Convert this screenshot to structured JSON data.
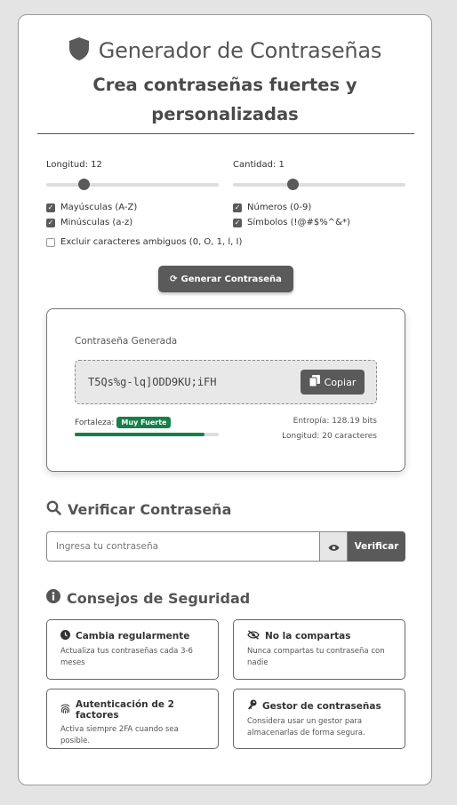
{
  "header": {
    "title": "Generador de Contraseñas",
    "subtitle_line1": "Crea contraseñas fuertes y",
    "subtitle_line2": "personalizadas"
  },
  "options": {
    "length_label": "Longitud: 12",
    "length_value": 12,
    "quantity_label": "Cantidad: 1",
    "quantity_value": 1,
    "uppercase": {
      "label": "Mayúsculas (A-Z)",
      "checked": true
    },
    "lowercase": {
      "label": "Minúsculas (a-z)",
      "checked": true
    },
    "numbers": {
      "label": "Números (0-9)",
      "checked": true
    },
    "symbols": {
      "label": "Símbolos (!@#$%^&*)",
      "checked": true
    },
    "exclude_ambiguous": {
      "label": "Excluir caracteres ambiguos (0, O, 1, l, I)",
      "checked": false
    }
  },
  "generate_button": "Generar Contraseña",
  "result": {
    "label": "Contraseña Generada",
    "password": "T5Qs%g-lq]ODD9KU;iFH",
    "copy_label": "Copiar",
    "strength_label": "Fortaleza:",
    "strength_badge": "Muy Fuerte",
    "strength_fraction": 0.9,
    "entropy": "Entropía: 128.19 bits",
    "length": "Longitud: 20 caracteres"
  },
  "verify": {
    "title": "Verificar Contraseña",
    "placeholder": "Ingresa tu contraseña",
    "button": "Verificar"
  },
  "tips": {
    "title": "Consejos de Seguridad",
    "items": [
      {
        "title": "Cambia regularmente",
        "text": "Actualiza tus contraseñas cada 3-6 meses",
        "icon": "clock-icon"
      },
      {
        "title": "No la compartas",
        "text": "Nunca compartas tu contraseña con nadie",
        "icon": "eye-slash-icon"
      },
      {
        "title": "Autenticación de 2 factores",
        "text": "Activa siempre 2FA cuando sea posible.",
        "icon": "fingerprint-icon"
      },
      {
        "title": "Gestor de contraseñas",
        "text": "Considera usar un gestor para almacenarlas de forma segura.",
        "icon": "key-icon"
      }
    ]
  },
  "colors": {
    "primary": "#5a5a5a",
    "strong": "#16804a"
  }
}
